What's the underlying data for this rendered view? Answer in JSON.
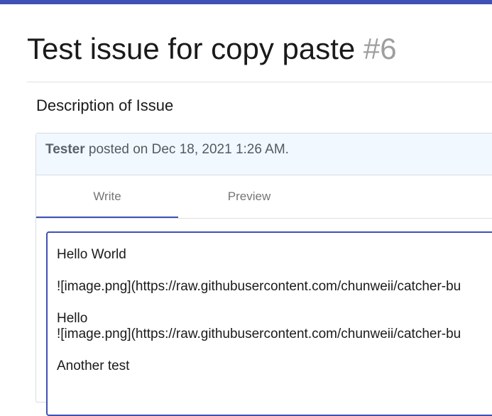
{
  "accent_color": "#3f51b5",
  "page": {
    "title": "Test issue for copy paste",
    "issue_number": "#6"
  },
  "section": {
    "heading": "Description of Issue"
  },
  "post": {
    "author": "Tester",
    "meta": " posted on Dec 18, 2021 1:26 AM."
  },
  "tabs": [
    {
      "label": "Write",
      "active": true
    },
    {
      "label": "Preview",
      "active": false
    }
  ],
  "editor": {
    "lines": [
      "Hello World",
      "![image.png](https://raw.githubusercontent.com/chunweii/catcher-bu",
      "Hello",
      "![image.png](https://raw.githubusercontent.com/chunweii/catcher-bu",
      "Another test"
    ]
  }
}
